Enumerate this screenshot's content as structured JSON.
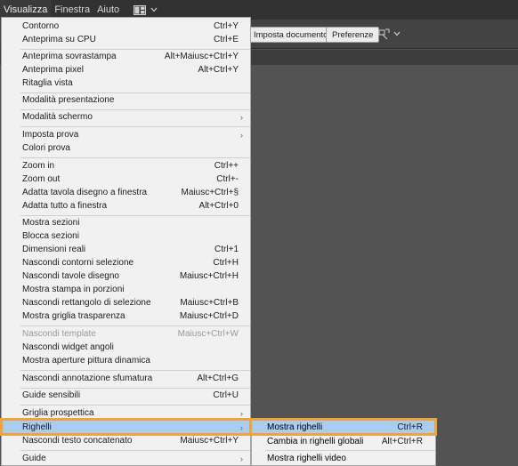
{
  "menubar": {
    "items": [
      "Visualizza",
      "Finestra",
      "Aiuto"
    ],
    "layout_icon": "grid-layout-icon",
    "chevron_icon": "chevron-down-icon"
  },
  "controlbar": {
    "import_button": "Imposta documento",
    "prefs_button": "Preferenze",
    "arrange_icon": "arrange-documents-icon"
  },
  "menu": {
    "items": [
      {
        "label": "Contorno",
        "shortcut": "Ctrl+Y"
      },
      {
        "label": "Anteprima su CPU",
        "shortcut": "Ctrl+E"
      },
      {
        "label": "Anteprima sovrastampa",
        "shortcut": "Alt+Maiusc+Ctrl+Y"
      },
      {
        "label": "Anteprima pixel",
        "shortcut": "Alt+Ctrl+Y"
      },
      {
        "label": "Ritaglia vista",
        "shortcut": ""
      },
      {
        "label": "Modalità presentazione",
        "shortcut": ""
      },
      {
        "label": "Modalità schermo",
        "shortcut": ""
      },
      {
        "label": "Imposta prova",
        "shortcut": ""
      },
      {
        "label": "Colori prova",
        "shortcut": ""
      },
      {
        "label": "Zoom in",
        "shortcut": "Ctrl++"
      },
      {
        "label": "Zoom out",
        "shortcut": "Ctrl+-"
      },
      {
        "label": "Adatta tavola disegno a finestra",
        "shortcut": "Maiusc+Ctrl+§"
      },
      {
        "label": "Adatta tutto a finestra",
        "shortcut": "Alt+Ctrl+0"
      },
      {
        "label": "Mostra sezioni",
        "shortcut": ""
      },
      {
        "label": "Blocca sezioni",
        "shortcut": ""
      },
      {
        "label": "Dimensioni reali",
        "shortcut": "Ctrl+1"
      },
      {
        "label": "Nascondi contorni selezione",
        "shortcut": "Ctrl+H"
      },
      {
        "label": "Nascondi tavole disegno",
        "shortcut": "Maiusc+Ctrl+H"
      },
      {
        "label": "Mostra stampa in porzioni",
        "shortcut": ""
      },
      {
        "label": "Nascondi rettangolo di selezione",
        "shortcut": "Maiusc+Ctrl+B"
      },
      {
        "label": "Mostra griglia trasparenza",
        "shortcut": "Maiusc+Ctrl+D"
      },
      {
        "label": "Nascondi template",
        "shortcut": "Maiusc+Ctrl+W"
      },
      {
        "label": "Nascondi widget angoli",
        "shortcut": ""
      },
      {
        "label": "Mostra aperture pittura dinamica",
        "shortcut": ""
      },
      {
        "label": "Nascondi annotazione sfumatura",
        "shortcut": "Alt+Ctrl+G"
      },
      {
        "label": "Guide sensibili",
        "shortcut": "Ctrl+U"
      },
      {
        "label": "Griglia prospettica",
        "shortcut": ""
      },
      {
        "label": "Righelli",
        "shortcut": ""
      },
      {
        "label": "Nascondi testo concatenato",
        "shortcut": "Maiusc+Ctrl+Y"
      },
      {
        "label": "Guide",
        "shortcut": ""
      }
    ],
    "submenu_arrow": "›"
  },
  "submenu": {
    "items": [
      {
        "label": "Mostra righelli",
        "shortcut": "Ctrl+R"
      },
      {
        "label": "Cambia in righelli globali",
        "shortcut": "Alt+Ctrl+R"
      },
      {
        "label": "Mostra righelli video",
        "shortcut": ""
      }
    ]
  },
  "colors": {
    "highlight": "#a9cdf0",
    "outline": "#f2a23b",
    "menu_bg": "#f1f1f1",
    "app_bg": "#535353"
  }
}
